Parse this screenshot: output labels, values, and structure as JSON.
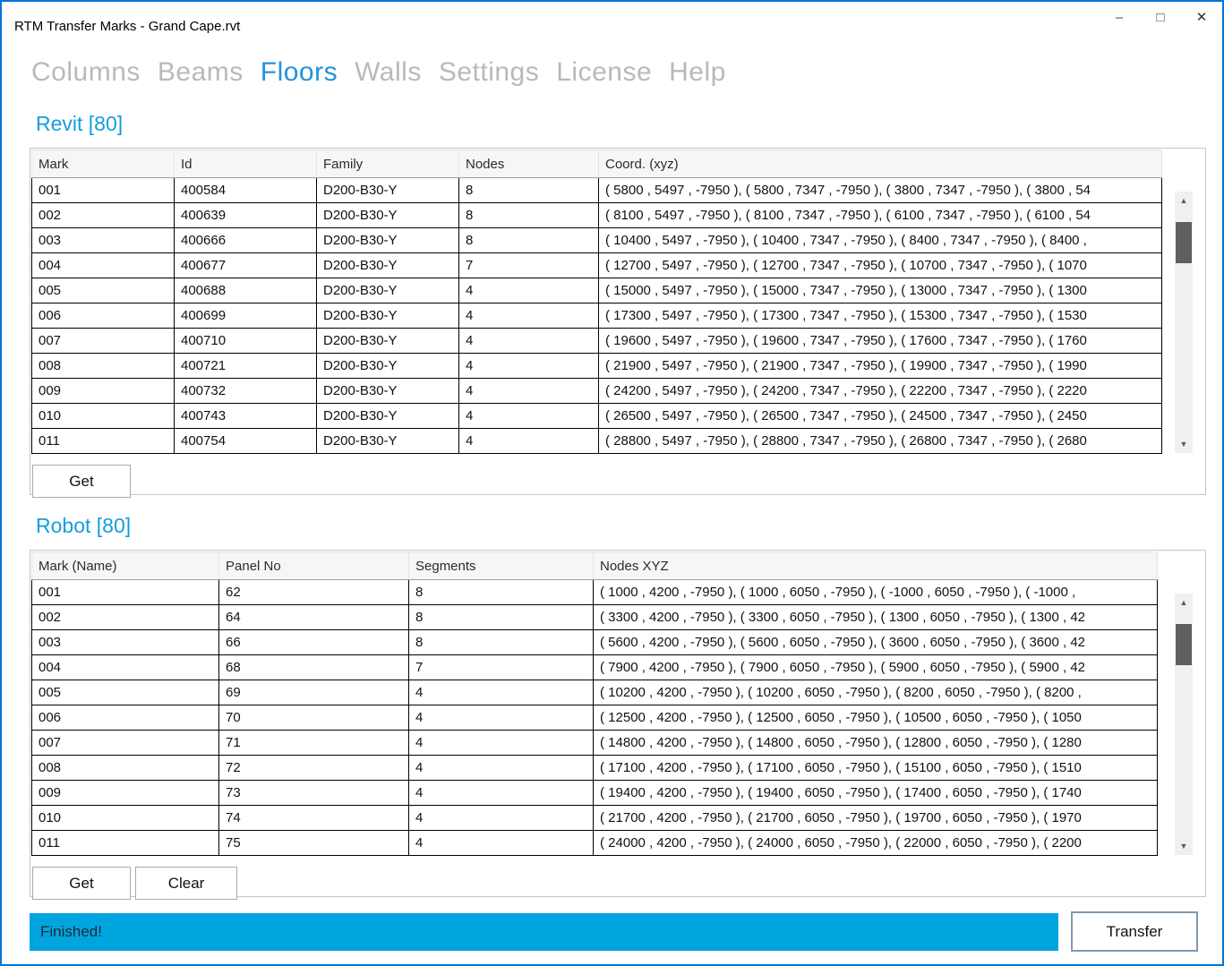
{
  "window": {
    "title": "RTM Transfer Marks - Grand Cape.rvt"
  },
  "icons": {
    "minimize": "–",
    "maximize": "□",
    "close": "✕",
    "scroll_up": "▲",
    "scroll_down": "▼"
  },
  "nav": {
    "items": [
      {
        "label": "Columns",
        "active": false
      },
      {
        "label": "Beams",
        "active": false
      },
      {
        "label": "Floors",
        "active": true
      },
      {
        "label": "Walls",
        "active": false
      },
      {
        "label": "Settings",
        "active": false
      },
      {
        "label": "License",
        "active": false
      },
      {
        "label": "Help",
        "active": false
      }
    ]
  },
  "revit": {
    "title": "Revit [80]",
    "columns": [
      "Mark",
      "Id",
      "Family",
      "Nodes",
      "Coord. (xyz)"
    ],
    "rows": [
      [
        "001",
        "400584",
        "D200-B30-Y",
        "8",
        "( 5800 , 5497 , -7950 ), ( 5800 , 7347 , -7950 ), ( 3800 , 7347 , -7950 ), ( 3800 , 54"
      ],
      [
        "002",
        "400639",
        "D200-B30-Y",
        "8",
        "( 8100 , 5497 , -7950 ), ( 8100 , 7347 , -7950 ), ( 6100 , 7347 , -7950 ), ( 6100 , 54"
      ],
      [
        "003",
        "400666",
        "D200-B30-Y",
        "8",
        "( 10400 , 5497 , -7950 ), ( 10400 , 7347 , -7950 ), ( 8400 , 7347 , -7950 ), ( 8400 ,"
      ],
      [
        "004",
        "400677",
        "D200-B30-Y",
        "7",
        "( 12700 , 5497 , -7950 ), ( 12700 , 7347 , -7950 ), ( 10700 , 7347 , -7950 ), ( 1070"
      ],
      [
        "005",
        "400688",
        "D200-B30-Y",
        "4",
        "( 15000 , 5497 , -7950 ), ( 15000 , 7347 , -7950 ), ( 13000 , 7347 , -7950 ), ( 1300"
      ],
      [
        "006",
        "400699",
        "D200-B30-Y",
        "4",
        "( 17300 , 5497 , -7950 ), ( 17300 , 7347 , -7950 ), ( 15300 , 7347 , -7950 ), ( 1530"
      ],
      [
        "007",
        "400710",
        "D200-B30-Y",
        "4",
        "( 19600 , 5497 , -7950 ), ( 19600 , 7347 , -7950 ), ( 17600 , 7347 , -7950 ), ( 1760"
      ],
      [
        "008",
        "400721",
        "D200-B30-Y",
        "4",
        "( 21900 , 5497 , -7950 ), ( 21900 , 7347 , -7950 ), ( 19900 , 7347 , -7950 ), ( 1990"
      ],
      [
        "009",
        "400732",
        "D200-B30-Y",
        "4",
        "( 24200 , 5497 , -7950 ), ( 24200 , 7347 , -7950 ), ( 22200 , 7347 , -7950 ), ( 2220"
      ],
      [
        "010",
        "400743",
        "D200-B30-Y",
        "4",
        "( 26500 , 5497 , -7950 ), ( 26500 , 7347 , -7950 ), ( 24500 , 7347 , -7950 ), ( 2450"
      ],
      [
        "011",
        "400754",
        "D200-B30-Y",
        "4",
        "( 28800 , 5497 , -7950 ), ( 28800 , 7347 , -7950 ), ( 26800 , 7347 , -7950 ), ( 2680"
      ]
    ],
    "get_label": "Get"
  },
  "robot": {
    "title": "Robot [80]",
    "columns": [
      "Mark (Name)",
      "Panel No",
      "Segments",
      "Nodes XYZ"
    ],
    "rows": [
      [
        "001",
        "62",
        "8",
        "( 1000 , 4200 , -7950 ), ( 1000 , 6050 , -7950 ), ( -1000 , 6050 , -7950 ), ( -1000 ,"
      ],
      [
        "002",
        "64",
        "8",
        "( 3300 , 4200 , -7950 ), ( 3300 , 6050 , -7950 ), ( 1300 , 6050 , -7950 ), ( 1300 , 42"
      ],
      [
        "003",
        "66",
        "8",
        "( 5600 , 4200 , -7950 ), ( 5600 , 6050 , -7950 ), ( 3600 , 6050 , -7950 ), ( 3600 , 42"
      ],
      [
        "004",
        "68",
        "7",
        "( 7900 , 4200 , -7950 ), ( 7900 , 6050 , -7950 ), ( 5900 , 6050 , -7950 ), ( 5900 , 42"
      ],
      [
        "005",
        "69",
        "4",
        "( 10200 , 4200 , -7950 ), ( 10200 , 6050 , -7950 ), ( 8200 , 6050 , -7950 ), ( 8200 ,"
      ],
      [
        "006",
        "70",
        "4",
        "( 12500 , 4200 , -7950 ), ( 12500 , 6050 , -7950 ), ( 10500 , 6050 , -7950 ), ( 1050"
      ],
      [
        "007",
        "71",
        "4",
        "( 14800 , 4200 , -7950 ), ( 14800 , 6050 , -7950 ), ( 12800 , 6050 , -7950 ), ( 1280"
      ],
      [
        "008",
        "72",
        "4",
        "( 17100 , 4200 , -7950 ), ( 17100 , 6050 , -7950 ), ( 15100 , 6050 , -7950 ), ( 1510"
      ],
      [
        "009",
        "73",
        "4",
        "( 19400 , 4200 , -7950 ), ( 19400 , 6050 , -7950 ), ( 17400 , 6050 , -7950 ), ( 1740"
      ],
      [
        "010",
        "74",
        "4",
        "( 21700 , 4200 , -7950 ), ( 21700 , 6050 , -7950 ), ( 19700 , 6050 , -7950 ), ( 1970"
      ],
      [
        "011",
        "75",
        "4",
        "( 24000 , 4200 , -7950 ), ( 24000 , 6050 , -7950 ), ( 22000 , 6050 , -7950 ), ( 2200"
      ]
    ],
    "get_label": "Get",
    "clear_label": "Clear"
  },
  "footer": {
    "status": "Finished!",
    "transfer_label": "Transfer"
  },
  "colors": {
    "accent": "#0078d7",
    "nav_inactive": "#b9b9b9",
    "nav_active": "#2492db",
    "section_title": "#129fdb",
    "status_bar": "#00a5e0"
  }
}
